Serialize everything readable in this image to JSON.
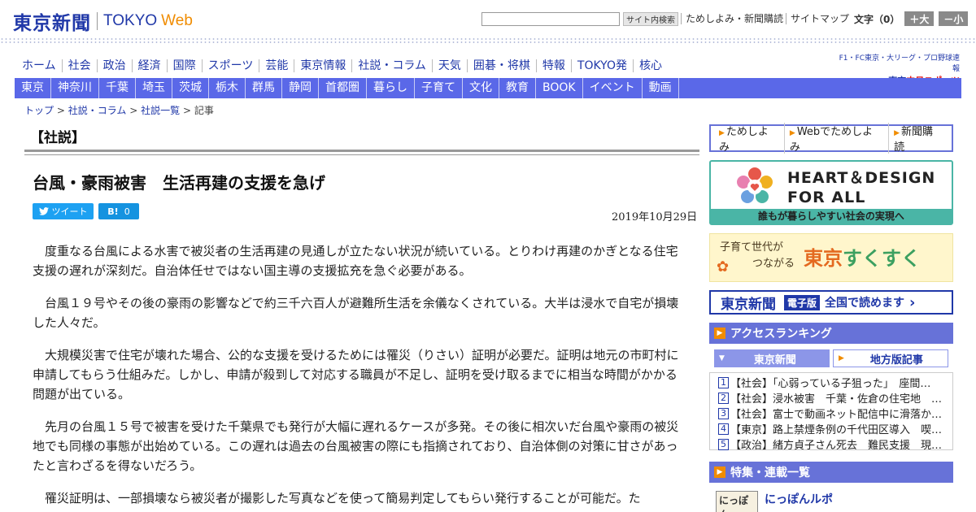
{
  "header": {
    "logo_jp": "東京新聞",
    "logo_en": "TOKYO",
    "logo_web": "Web",
    "search_button": "サイト内検索",
    "links": [
      "ためしよみ・新聞購読",
      "サイトマップ"
    ],
    "font_size_label": "文字（0）",
    "font_larger": "＋大",
    "font_smaller": "－小"
  },
  "nav_main": [
    "ホーム",
    "社会",
    "政治",
    "経済",
    "国際",
    "スポーツ",
    "芸能",
    "東京情報",
    "社説・コラム",
    "天気",
    "囲碁・将棋",
    "特報",
    "TOKYO発",
    "核心"
  ],
  "chunichi_sports": {
    "line1": "F1・FC東京・大リーグ・プロ野球速報",
    "line2_prefix": "▶東京",
    "line2_brand": "中日スポーツ"
  },
  "nav_region": [
    "東京",
    "神奈川",
    "千葉",
    "埼玉",
    "茨城",
    "栃木",
    "群馬",
    "静岡",
    "首都圏",
    "暮らし",
    "子育て",
    "文化",
    "教育",
    "BOOK",
    "イベント",
    "動画"
  ],
  "breadcrumb": {
    "items": [
      "トップ",
      "社説・コラム",
      "社説一覧"
    ],
    "current": "記事",
    "separator": ">"
  },
  "article": {
    "section": "【社説】",
    "headline": "台風・豪雨被害　生活再建の支援を急げ",
    "tweet_label": "ツイート",
    "hatena_label": "B!",
    "hatena_count": "0",
    "date": "2019年10月29日",
    "paragraphs": [
      "度重なる台風による水害で被災者の生活再建の見通しが立たない状況が続いている。とりわけ再建のかぎとなる住宅支援の遅れが深刻だ。自治体任せではない国主導の支援拡充を急ぐ必要がある。",
      "台風１９号やその後の豪雨の影響などで約三千六百人が避難所生活を余儀なくされている。大半は浸水で自宅が損壊した人々だ。",
      "大規模災害で住宅が壊れた場合、公的な支援を受けるためには罹災（りさい）証明が必要だ。証明は地元の市町村に申請してもらう仕組みだ。しかし、申請が殺到して対応する職員が不足し、証明を受け取るまでに相当な時間がかかる問題が出ている。",
      "先月の台風１５号で被害を受けた千葉県でも発行が大幅に遅れるケースが多発。その後に相次いだ台風や豪雨の被災地でも同様の事態が出始めている。この遅れは過去の台風被害の際にも指摘されており、自治体側の対策に甘さがあったと言わざるを得ないだろう。",
      "罹災証明は、一部損壊なら被災者が撮影した写真などを使って簡易判定してもらい発行することが可能だ。た"
    ]
  },
  "sidebar": {
    "subscribe_tabs": [
      "ためしよみ",
      "Webでためしよみ",
      "新聞購読"
    ],
    "heart_design": {
      "title_line1": "HEART＆DESIGN",
      "title_line2": "FOR ALL",
      "band": "誰もが暮らしやすい社会の実現へ"
    },
    "sukusuku": {
      "sub_line1": "子育て世代が",
      "sub_line2": "つながる",
      "brand_a": "東京",
      "brand_b": "すくすく"
    },
    "denshi": {
      "logo": "東京新聞",
      "tag": "電子版",
      "text": "全国で読めます"
    },
    "ranking": {
      "title": "アクセスランキング",
      "tab_active": "東京新聞",
      "tab_other": "地方版記事",
      "items": [
        {
          "num": "1",
          "text": "【社会】「心弱っている子狙った」　座間…"
        },
        {
          "num": "2",
          "text": "【社会】浸水被害　千葉・佐倉の住宅地　…"
        },
        {
          "num": "3",
          "text": "【社会】富士で動画ネット配信中に滑落か…"
        },
        {
          "num": "4",
          "text": "【東京】路上禁煙条例の千代田区導入　喫…"
        },
        {
          "num": "5",
          "text": "【政治】緒方貞子さん死去　難民支援　現…"
        }
      ]
    },
    "features": {
      "title": "特集・連載一覧",
      "first_thumb": "にっぽん",
      "first_title": "にっぽんルポ"
    }
  }
}
